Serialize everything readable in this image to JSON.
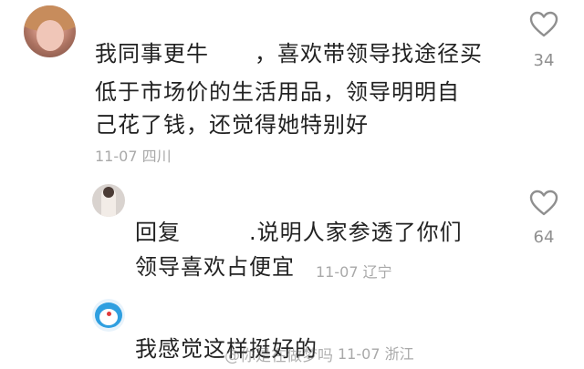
{
  "comments": [
    {
      "lines": [
        "我同事更牛　　，喜欢带领导找途径买",
        "低于市场价的生活用品，领导明明自",
        "己花了钱，还觉得她特别好"
      ],
      "date": "11-07",
      "location": "四川",
      "like_count": "34",
      "avatar_icon": "doll-avatar"
    },
    {
      "lines": [
        "回复　　　.说明人家参透了你们",
        "领导喜欢占便宜"
      ],
      "date": "11-07",
      "location": "辽宁",
      "like_count": "64",
      "avatar_icon": "girl-avatar"
    },
    {
      "lines": [
        "我感觉这样挺好的"
      ],
      "date": "11-07",
      "location": "浙江",
      "avatar_icon": "doraemon-avatar"
    }
  ],
  "watermark": "@你是在做梦吗",
  "colors": {
    "text": "#222222",
    "meta": "#a9a9a9",
    "icon": "#8f8f8f"
  }
}
